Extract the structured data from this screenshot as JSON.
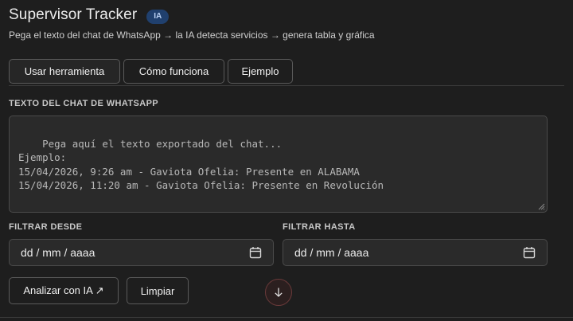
{
  "header": {
    "title": "Supervisor Tracker",
    "badge": "IA",
    "subtitle": "Pega el texto del chat de WhatsApp → la IA detecta servicios → genera tabla y gráfica"
  },
  "tabs": [
    {
      "label": "Usar herramienta",
      "active": true
    },
    {
      "label": "Cómo funciona",
      "active": false
    },
    {
      "label": "Ejemplo",
      "active": false
    }
  ],
  "chat_input": {
    "label": "TEXTO DEL CHAT DE WHATSAPP",
    "placeholder": "Pega aquí el texto exportado del chat...\nEjemplo:\n15/04/2026, 9:26 am - Gaviota Ofelia: Presente en ALABAMA\n15/04/2026, 11:20 am - Gaviota Ofelia: Presente en Revolución"
  },
  "filters": {
    "from_label": "FILTRAR DESDE",
    "from_value": "dd / mm / aaaa",
    "to_label": "FILTRAR HASTA",
    "to_value": "dd / mm / aaaa"
  },
  "actions": {
    "analyze_label": "Analizar con IA ↗",
    "clear_label": "Limpiar"
  },
  "icons": {
    "calendar": "calendar-icon",
    "scroll_down": "arrow-down-icon"
  },
  "colors": {
    "background": "#1e1e1e",
    "badge_bg": "#20406e",
    "scroll_button_border": "#6b3a3a"
  }
}
